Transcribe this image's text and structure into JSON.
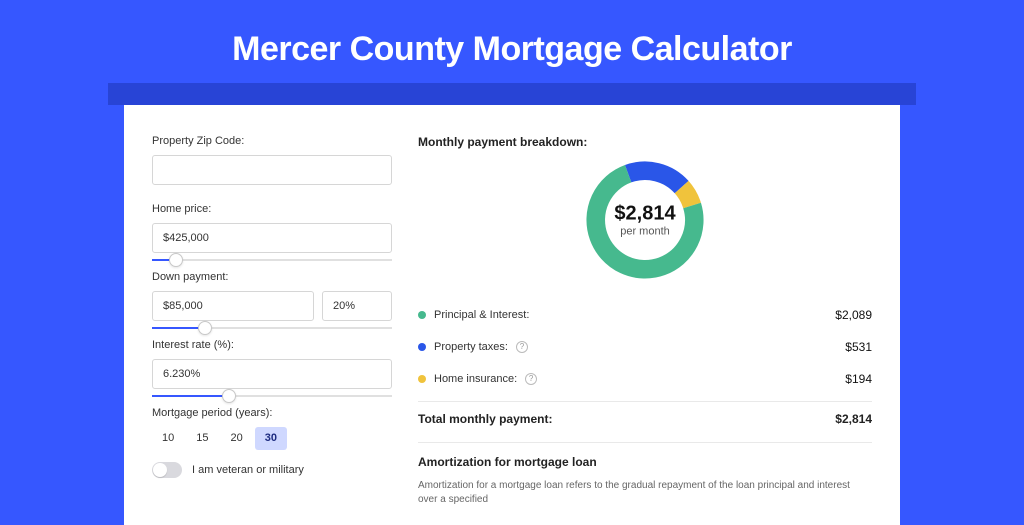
{
  "title": "Mercer County Mortgage Calculator",
  "left": {
    "zip": {
      "label": "Property Zip Code:",
      "value": ""
    },
    "home": {
      "label": "Home price:",
      "value": "$425,000",
      "slider_frac": 0.1
    },
    "down": {
      "label": "Down payment:",
      "value": "$85,000",
      "pct": "20%",
      "slider_frac": 0.22
    },
    "rate": {
      "label": "Interest rate (%):",
      "value": "6.230%",
      "slider_frac": 0.32
    },
    "period": {
      "label": "Mortgage period (years):",
      "options": [
        "10",
        "15",
        "20",
        "30"
      ],
      "active_index": 3
    },
    "veteran": {
      "label": "I am veteran or military",
      "on": false
    }
  },
  "right": {
    "section_title": "Monthly payment breakdown:",
    "center_amount": "$2,814",
    "center_sub": "per month",
    "legend": [
      {
        "label": "Principal & Interest:",
        "amount": "$2,089",
        "color": "#46b98e",
        "help": false
      },
      {
        "label": "Property taxes:",
        "amount": "$531",
        "color": "#2a56e8",
        "help": true
      },
      {
        "label": "Home insurance:",
        "amount": "$194",
        "color": "#f0c33c",
        "help": true
      }
    ],
    "total_label": "Total monthly payment:",
    "total_amount": "$2,814",
    "amort_title": "Amortization for mortgage loan",
    "amort_text": "Amortization for a mortgage loan refers to the gradual repayment of the loan principal and interest over a specified"
  },
  "chart_data": {
    "type": "pie",
    "title": "Monthly payment breakdown",
    "series": [
      {
        "name": "Principal & Interest",
        "value": 2089,
        "color": "#46b98e"
      },
      {
        "name": "Property taxes",
        "value": 531,
        "color": "#2a56e8"
      },
      {
        "name": "Home insurance",
        "value": 194,
        "color": "#f0c33c"
      }
    ],
    "total": 2814,
    "center_label": "$2,814 per month"
  }
}
